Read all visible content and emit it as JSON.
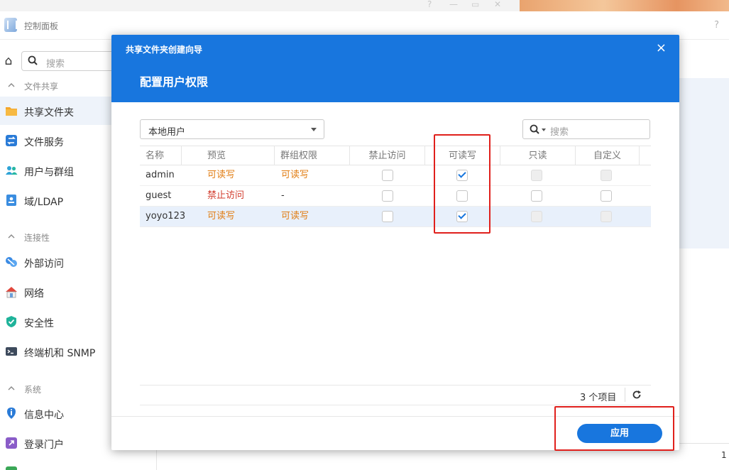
{
  "control_panel": {
    "title": "控制面板",
    "help": "?",
    "search_placeholder": "搜索"
  },
  "sidebar": {
    "sections": [
      {
        "label": "文件共享"
      },
      {
        "label": "连接性"
      },
      {
        "label": "系统"
      }
    ],
    "items": [
      {
        "label": "共享文件夹",
        "icon": "folder-icon"
      },
      {
        "label": "文件服务",
        "icon": "file-services-icon"
      },
      {
        "label": "用户与群组",
        "icon": "users-icon"
      },
      {
        "label": "域/LDAP",
        "icon": "domain-icon"
      },
      {
        "label": "外部访问",
        "icon": "external-access-icon"
      },
      {
        "label": "网络",
        "icon": "network-icon"
      },
      {
        "label": "安全性",
        "icon": "shield-icon"
      },
      {
        "label": "终端机和 SNMP",
        "icon": "terminal-icon"
      },
      {
        "label": "信息中心",
        "icon": "info-icon"
      },
      {
        "label": "登录门户",
        "icon": "login-portal-icon"
      }
    ]
  },
  "right_panel": {
    "footer_number": "1"
  },
  "modal": {
    "title": "共享文件夹创建向导",
    "subtitle": "配置用户权限",
    "close": "×",
    "user_type": "本地用户",
    "search_placeholder": "搜索",
    "columns": [
      "名称",
      "预览",
      "群组权限",
      "禁止访问",
      "可读写",
      "只读",
      "自定义"
    ],
    "rows": [
      {
        "name": "admin",
        "preview": "可读写",
        "group": "可读写",
        "deny": false,
        "rw": true,
        "ro": false,
        "custom": false
      },
      {
        "name": "guest",
        "preview": "禁止访问",
        "group": "-",
        "deny": false,
        "rw": false,
        "ro": false,
        "custom": false
      },
      {
        "name": "yoyo123",
        "preview": "可读写",
        "group": "可读写",
        "deny": false,
        "rw": true,
        "ro": false,
        "custom": false
      }
    ],
    "item_count": "3 个项目",
    "apply_label": "应用"
  },
  "colors": {
    "accent": "#1876de",
    "permission_rw": "#e17d13",
    "permission_deny": "#d23c2d",
    "annotation": "#e0201c"
  }
}
